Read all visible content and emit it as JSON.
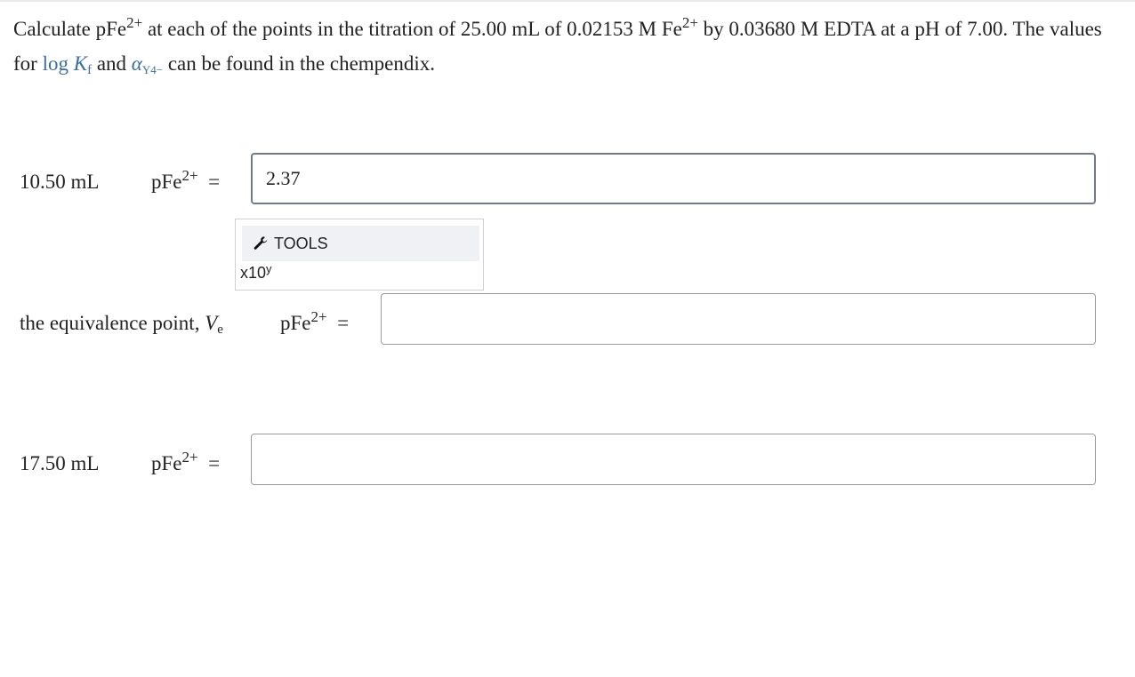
{
  "question": {
    "part1": "Calculate pFe",
    "sup1": "2+",
    "part2": " at each of the points in the titration of 25.00 mL of 0.02153 M Fe",
    "sup2": "2+",
    "part3": " by 0.03680 M EDTA at a pH of 7.00. The values for ",
    "link_log": "log ",
    "link_k": "K",
    "link_k_sub": "f",
    "and": " and ",
    "link_alpha": "α",
    "link_alpha_sub": "Y4−",
    "part4": " can be found in the chempendix."
  },
  "rows": [
    {
      "label": "10.50 mL",
      "quantity": "pFe",
      "quantity_sup": "2+",
      "equals": "=",
      "value": "2.37"
    },
    {
      "label_prefix": "the equivalence point, ",
      "label_var": "V",
      "label_sub": "e",
      "quantity": "pFe",
      "quantity_sup": "2+",
      "equals": "=",
      "value": ""
    },
    {
      "label": "17.50 mL",
      "quantity": "pFe",
      "quantity_sup": "2+",
      "equals": "=",
      "value": ""
    }
  ],
  "tools": {
    "button_label": "TOOLS",
    "icon": "wrench-icon",
    "sci_notation_base": "x10",
    "sci_notation_exp": "y"
  }
}
